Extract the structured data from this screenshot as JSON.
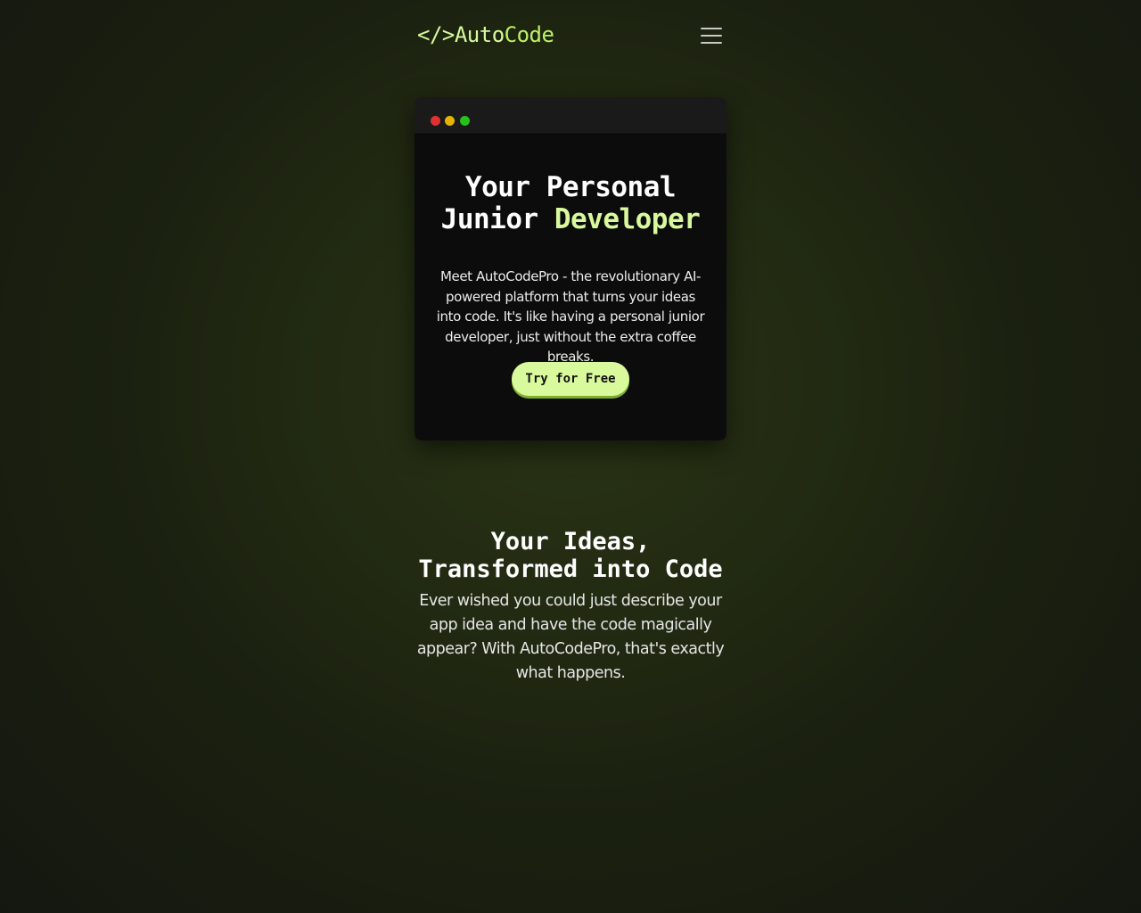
{
  "header": {
    "logo": {
      "brackets": "</>",
      "auto": "Auto",
      "code": "Code"
    },
    "menu_icon": "hamburger-menu-icon"
  },
  "hero": {
    "window_dots": [
      "red",
      "yellow",
      "green"
    ],
    "title_line1": "Your Personal",
    "title_line2_plain": "Junior ",
    "title_line2_accent": "Developer",
    "description": "Meet AutoCodePro - the revolutionary AI-powered platform that turns your ideas into code. It's like having a personal junior developer, just without the extra coffee breaks.",
    "cta_label": "Try for Free"
  },
  "features": {
    "title_line1": "Your Ideas,",
    "title_line2": "Transformed into Code",
    "description": "Ever wished you could just describe your app idea and have the code magically appear? With AutoCodePro, that's exactly what happens."
  },
  "colors": {
    "accent": "#d9f99d",
    "accent_shadow": "#7fae2e",
    "window_bg": "#0c0c0c",
    "dot_red": "#e03131",
    "dot_yellow": "#e5b400",
    "dot_green": "#24c21b"
  }
}
